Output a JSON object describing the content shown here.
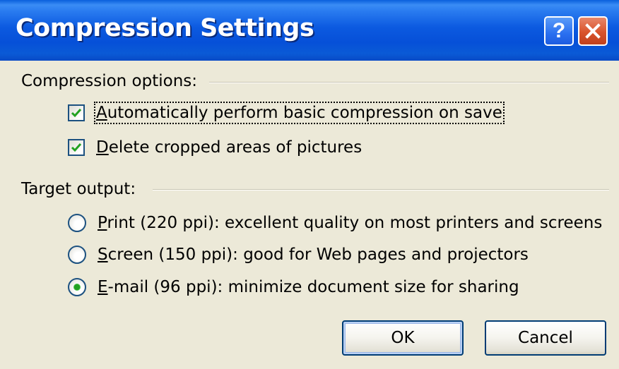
{
  "window": {
    "title": "Compression Settings"
  },
  "titlebar_buttons": {
    "help_label": "?",
    "help_icon": "help-icon",
    "close_icon": "close-icon"
  },
  "compression_options": {
    "label": "Compression options:",
    "items": [
      {
        "mnemonic": "A",
        "rest": "utomatically perform basic compression on save",
        "checked": true,
        "focused": true
      },
      {
        "mnemonic": "D",
        "rest": "elete cropped areas of pictures",
        "checked": true,
        "focused": false
      }
    ]
  },
  "target_output": {
    "label": "Target output:",
    "items": [
      {
        "mnemonic": "P",
        "rest": "rint (220 ppi): excellent quality on most printers and screens",
        "selected": false
      },
      {
        "mnemonic": "S",
        "rest": "creen (150 ppi): good for Web pages and projectors",
        "selected": false
      },
      {
        "mnemonic": "E",
        "rest": "-mail (96 ppi): minimize document size for sharing",
        "selected": true
      }
    ]
  },
  "buttons": {
    "ok": "OK",
    "cancel": "Cancel"
  },
  "colors": {
    "titlebar": "#0a5ad6",
    "dialog_bg": "#ece9d8",
    "check_green": "#21a121",
    "close_red": "#d9532b"
  }
}
